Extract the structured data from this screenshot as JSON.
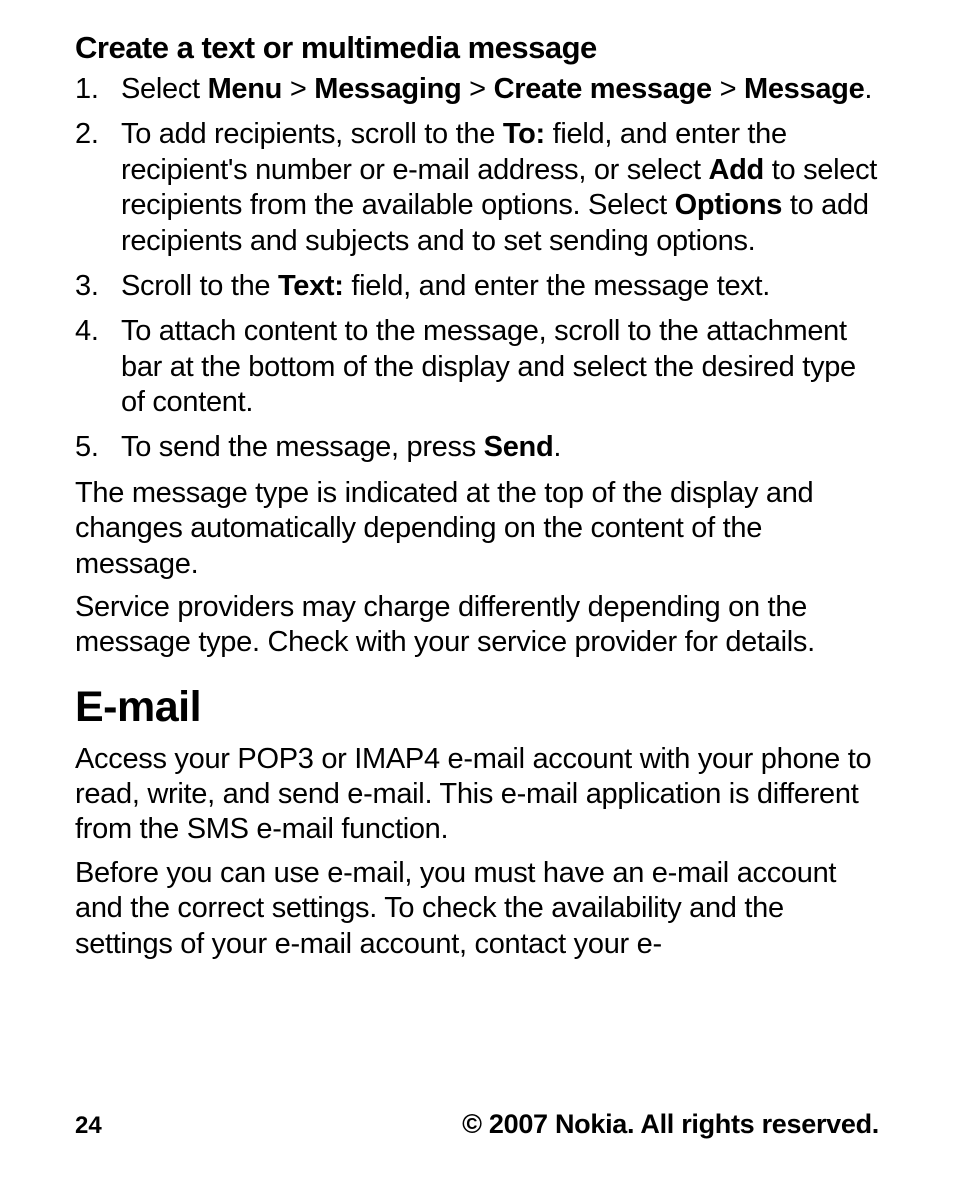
{
  "section1": {
    "heading": "Create a text or multimedia message",
    "step1": {
      "prefix": "Select ",
      "menu": "Menu",
      "sep1": "  >  ",
      "messaging": "Messaging",
      "sep2": "  >  ",
      "create": "Create message",
      "sep3": "  > ",
      "message": "Message",
      "suffix": "."
    },
    "step2": {
      "part1": "To add recipients, scroll to the ",
      "to": "To:",
      "part2": " field, and enter the recipient's number or e-mail address, or select ",
      "add": "Add",
      "part3": " to select recipients from the available options. Select ",
      "options": "Options",
      "part4": " to add recipients and subjects and to set sending options."
    },
    "step3": {
      "part1": "Scroll to the ",
      "text": "Text:",
      "part2": " field, and enter the message text."
    },
    "step4": "To attach content to the message, scroll to the attachment bar at the bottom of the display and select the desired type of content.",
    "step5": {
      "part1": "To send the message, press ",
      "send": "Send",
      "suffix": "."
    },
    "para1": "The message type is indicated at the top of the display and changes automatically depending on the content of the message.",
    "para2": "Service providers may charge differently depending on the message type. Check with your service provider for details."
  },
  "section2": {
    "heading": "E-mail",
    "para1": "Access your POP3 or IMAP4 e-mail account with your phone to read, write, and send e-mail. This e-mail application is different from the SMS e-mail function.",
    "para2": "Before you can use e-mail, you must have an e-mail account and the correct settings. To check the availability and the settings of your e-mail account, contact your e-"
  },
  "footer": {
    "page": "24",
    "copyright": "© 2007 Nokia. All rights reserved."
  }
}
